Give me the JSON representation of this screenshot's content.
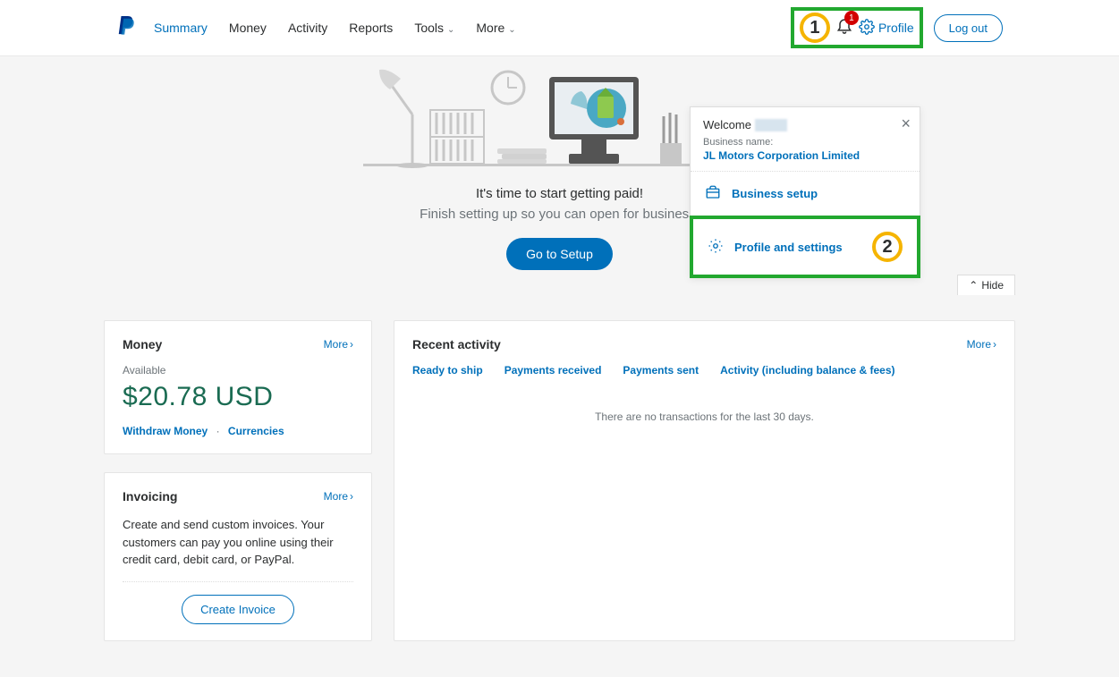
{
  "nav": {
    "summary": "Summary",
    "money": "Money",
    "activity": "Activity",
    "reports": "Reports",
    "tools": "Tools",
    "more": "More"
  },
  "header": {
    "notif_count": "1",
    "profile": "Profile",
    "logout": "Log out"
  },
  "annotations": {
    "step1": "1",
    "step2": "2"
  },
  "dropdown": {
    "welcome": "Welcome",
    "business_name_label": "Business name:",
    "business_name": "JL Motors Corporation Limited",
    "business_setup": "Business setup",
    "profile_settings": "Profile and settings"
  },
  "hero": {
    "line1": "It's time to start getting paid!",
    "line2": "Finish setting up so you can open for business.",
    "button": "Go to Setup"
  },
  "hide": "Hide",
  "money_card": {
    "title": "Money",
    "more": "More",
    "available": "Available",
    "balance": "$20.78 USD",
    "withdraw": "Withdraw Money",
    "currencies": "Currencies"
  },
  "invoicing_card": {
    "title": "Invoicing",
    "more": "More",
    "desc": "Create and send custom invoices. Your customers can pay you online using their credit card, debit card, or PayPal.",
    "button": "Create Invoice"
  },
  "activity_card": {
    "title": "Recent activity",
    "more": "More",
    "tabs": {
      "ready": "Ready to ship",
      "received": "Payments received",
      "sent": "Payments sent",
      "activity": "Activity (including balance & fees)"
    },
    "empty": "There are no transactions for the last 30 days."
  }
}
